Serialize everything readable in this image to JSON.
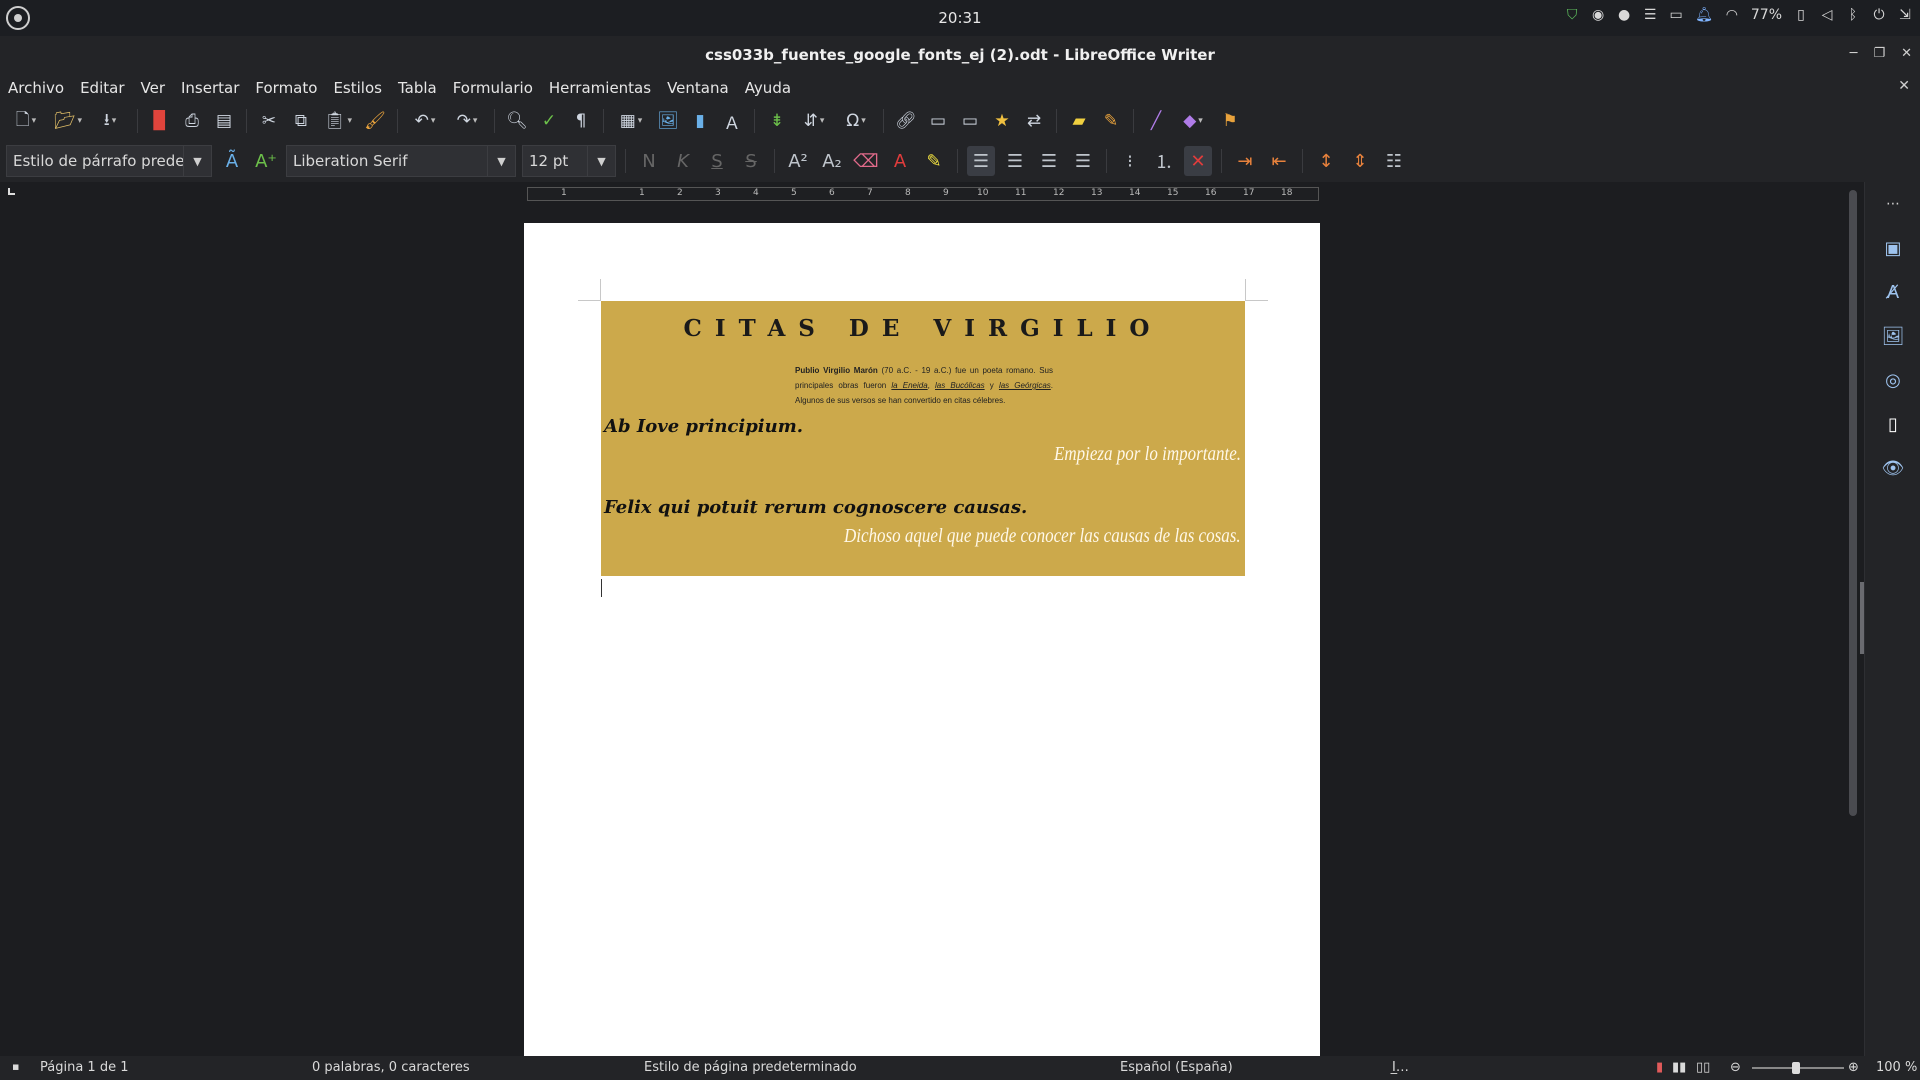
{
  "system": {
    "clock": "20:31",
    "battery": "77%"
  },
  "window": {
    "title": "css033b_fuentes_google_fonts_ej (2).odt - LibreOffice Writer"
  },
  "menu": [
    "Archivo",
    "Editar",
    "Ver",
    "Insertar",
    "Formato",
    "Estilos",
    "Tabla",
    "Formulario",
    "Herramientas",
    "Ventana",
    "Ayuda"
  ],
  "format_bar": {
    "paragraph_style": "Estilo de párrafo prede",
    "font_name": "Liberation Serif",
    "font_size": "12 pt",
    "bold_label": "N",
    "italic_label": "K",
    "underline_label": "S"
  },
  "ruler": {
    "left_numbers": [
      "1"
    ],
    "numbers": [
      "1",
      "2",
      "3",
      "4",
      "5",
      "6",
      "7",
      "8",
      "9",
      "10",
      "11",
      "12",
      "13",
      "14",
      "15",
      "16",
      "17",
      "18"
    ]
  },
  "document": {
    "heading": "CITAS DE VIRGILIO",
    "intro": {
      "author": "Publio Virgilio Marón",
      "text1": " (70 a.C. - 19 a.C.) fue un poeta romano. Sus principales obras fueron ",
      "work1": "la Eneida",
      "sep1": ", ",
      "work2": "las Bucólicas",
      "sep2": " y ",
      "work3": "las Geórgicas",
      "text2": ". Algunos de sus versos se han convertido en citas célebres."
    },
    "quotes": [
      {
        "latin": "Ab Iove principium.",
        "translation": "Empieza por lo importante."
      },
      {
        "latin": "Felix qui potuit rerum cognoscere causas.",
        "translation": "Dichoso aquel que puede conocer las causas de las cosas."
      }
    ]
  },
  "status": {
    "page": "Página 1 de 1",
    "words": "0 palabras, 0 caracteres",
    "page_style": "Estilo de página predeterminado",
    "language": "Español (España)",
    "zoom": "100 %",
    "zoom_level": 1.0
  },
  "colors": {
    "banner": "#cca94b",
    "accent": "#9ec3ee"
  }
}
